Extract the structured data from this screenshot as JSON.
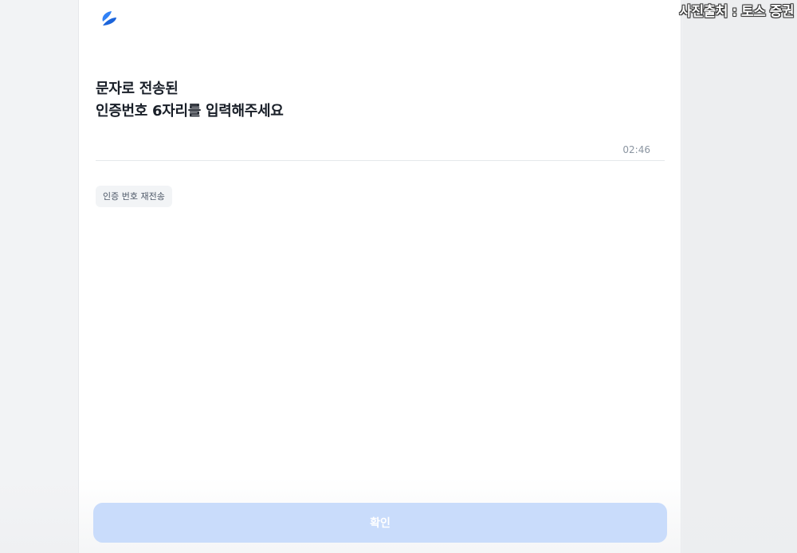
{
  "logo": {
    "icon": "toss-logo-icon",
    "color": "#1b64da"
  },
  "heading": {
    "line1": "문자로 전송된",
    "line2": "인증번호 6자리를 입력해주세요"
  },
  "code_input": {
    "value": "",
    "placeholder": ""
  },
  "timer": "02:46",
  "resend_label": "인증 번호 재전송",
  "confirm_label": "확인",
  "watermark": "사진출처 : 토스 증권",
  "colors": {
    "accent": "#3182f6",
    "confirm_disabled": "#c9dcfb",
    "text_primary": "#191f28",
    "text_secondary": "#8b95a1"
  }
}
